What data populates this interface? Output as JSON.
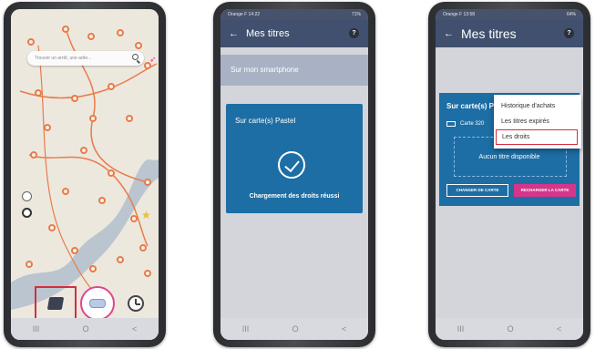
{
  "phone1": {
    "status": "",
    "search_placeholder": "Trouver un arrêt, une adre...",
    "bottom_nav": [
      "",
      "",
      ""
    ]
  },
  "phone2": {
    "status_left": "Orange F 14:22",
    "status_right": "71%",
    "appbar": {
      "title": "Mes titres"
    },
    "smartphone_row": "Sur mon smartphone",
    "card_label": "Sur carte(s) Pastel",
    "success_message": "Chargement des droits réussi",
    "nav": [
      "III",
      "O",
      "<"
    ]
  },
  "phone3": {
    "status_left": "Orange F 13:58",
    "status_right": "64%",
    "appbar": {
      "title": "Mes titres"
    },
    "card_label": "Sur carte(s) P",
    "card_id_text": "Carte 320",
    "empty_message": "Aucun titre disponible",
    "change_card": "CHANGER DE CARTE",
    "reload_card": "RECHARGER LA CARTE",
    "menu": [
      "Historique d'achats",
      "Les titres expirés",
      "Les droits"
    ],
    "nav": [
      "III",
      "O",
      "<"
    ]
  },
  "colors": {
    "app_bar": "#40506e",
    "card_blue": "#1d6ea4",
    "accent_pink": "#d6368a",
    "highlight_red": "#d32f3e",
    "map_route": "#e97b4a"
  }
}
